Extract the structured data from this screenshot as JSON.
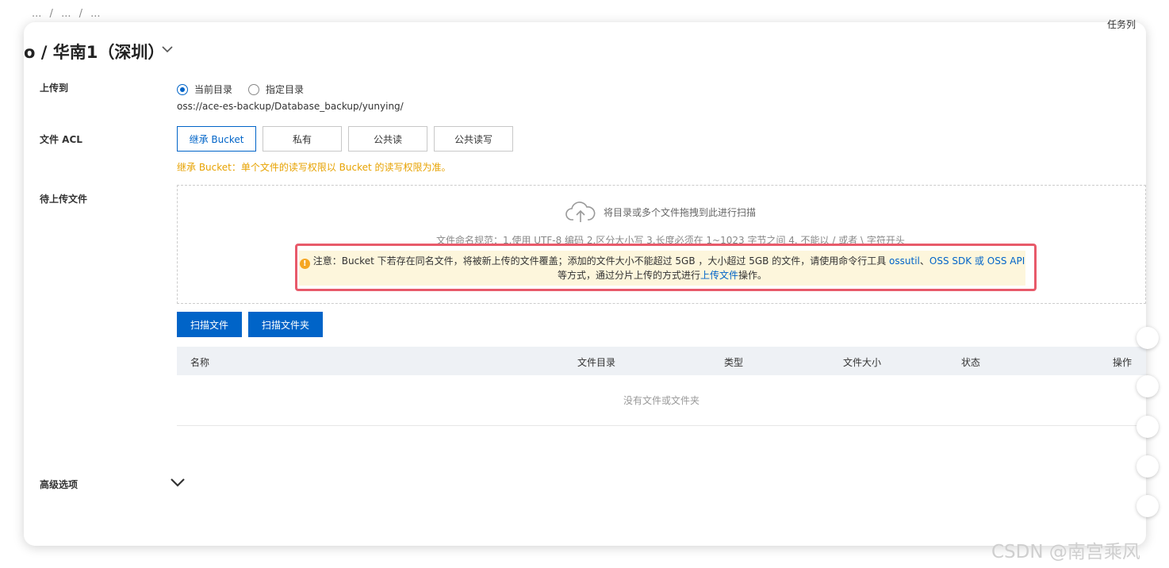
{
  "breadcrumb": {
    "parts": [
      "...",
      "/",
      "...",
      "/",
      "..."
    ]
  },
  "header": {
    "title": "o / 华南1（深圳）",
    "task_label": "任务列"
  },
  "upload_to": {
    "label": "上传到",
    "options": [
      {
        "label": "当前目录",
        "selected": true
      },
      {
        "label": "指定目录",
        "selected": false
      }
    ],
    "path": "oss://ace-es-backup/Database_backup/yunying/"
  },
  "acl": {
    "label": "文件 ACL",
    "options": [
      "继承 Bucket",
      "私有",
      "公共读",
      "公共读写"
    ],
    "selected": "继承 Bucket",
    "hint": "继承 Bucket：单个文件的读写权限以 Bucket 的读写权限为准。"
  },
  "files": {
    "label": "待上传文件",
    "drop_text": "将目录或多个文件拖拽到此进行扫描",
    "naming_rule": "文件命名规范：1.使用 UTF-8 编码 2.区分大小写 3.长度必须在 1~1023 字节之间 4. 不能以 / 或者 \\ 字符开头",
    "notice": {
      "prefix": "注意：Bucket 下若存在同名文件，将被新上传的文件覆盖；添加的文件大小不能超过 5GB ，大小超过 5GB 的文件，请使用命令行工具 ",
      "link1": "ossutil",
      "sep1": "、",
      "link2": "OSS SDK",
      "sep2": " 或 ",
      "link3": "OSS API",
      "line2_prefix": "等方式，通过分片上传的方式进行",
      "link4": "上传文件",
      "line2_suffix": "操作。"
    },
    "scan_file_button": "扫描文件",
    "scan_folder_button": "扫描文件夹",
    "columns": [
      "名称",
      "文件目录",
      "类型",
      "文件大小",
      "状态",
      "操作"
    ],
    "empty_text": "没有文件或文件夹"
  },
  "advanced": {
    "label": "高级选项"
  },
  "watermark": "CSDN @南宫乘风",
  "colors": {
    "primary": "#0064c8",
    "warning": "#e7a200",
    "notice_bg": "#fdf6dc",
    "highlight_border": "#e85a6a"
  }
}
